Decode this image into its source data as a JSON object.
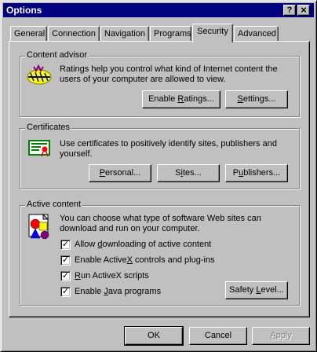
{
  "window": {
    "title": "Options"
  },
  "titlebar_buttons": {
    "help": "?",
    "close": "×"
  },
  "tabs": [
    {
      "label": "General"
    },
    {
      "label": "Connection"
    },
    {
      "label": "Navigation"
    },
    {
      "label": "Programs"
    },
    {
      "label": "Security"
    },
    {
      "label": "Advanced"
    }
  ],
  "active_tab": "Security",
  "content_advisor": {
    "title": "Content advisor",
    "description_line1": "Ratings help you control what kind of Internet content the",
    "description_line2": "users of your computer are allowed to view.",
    "enable_ratings_pre": "Enable ",
    "enable_ratings_u": "R",
    "enable_ratings_post": "atings...",
    "settings_pre": "",
    "settings_u": "S",
    "settings_post": "ettings..."
  },
  "certificates": {
    "title": "Certificates",
    "description_line1": "Use certificates to positively identify sites, publishers and",
    "description_line2": "yourself.",
    "personal_pre": "",
    "personal_u": "P",
    "personal_post": "ersonal...",
    "sites_pre": "S",
    "sites_u": "i",
    "sites_post": "tes...",
    "publishers_pre": "P",
    "publishers_u": "u",
    "publishers_post": "blishers..."
  },
  "active_content": {
    "title": "Active content",
    "description_line1": "You can choose what type of software Web sites can",
    "description_line2": "download and run on your computer.",
    "options": [
      {
        "pre": "Allow ",
        "u": "d",
        "post": "ownloading of active content",
        "checked": true
      },
      {
        "pre": "Enable Active",
        "u": "X",
        "post": " controls and plug-ins",
        "checked": true
      },
      {
        "pre": "",
        "u": "R",
        "post": "un ActiveX scripts",
        "checked": true
      },
      {
        "pre": "Enable ",
        "u": "J",
        "post": "ava programs",
        "checked": true
      }
    ],
    "check_mark": "✓",
    "safety_pre": "Safety ",
    "safety_u": "L",
    "safety_post": "evel..."
  },
  "footer": {
    "ok": "OK",
    "cancel": "Cancel",
    "apply_pre": "",
    "apply_u": "A",
    "apply_post": "pply"
  },
  "icons": {
    "content_advisor": "ratings-icon",
    "certificates": "certificate-icon",
    "active_content": "active-content-shapes-icon"
  }
}
